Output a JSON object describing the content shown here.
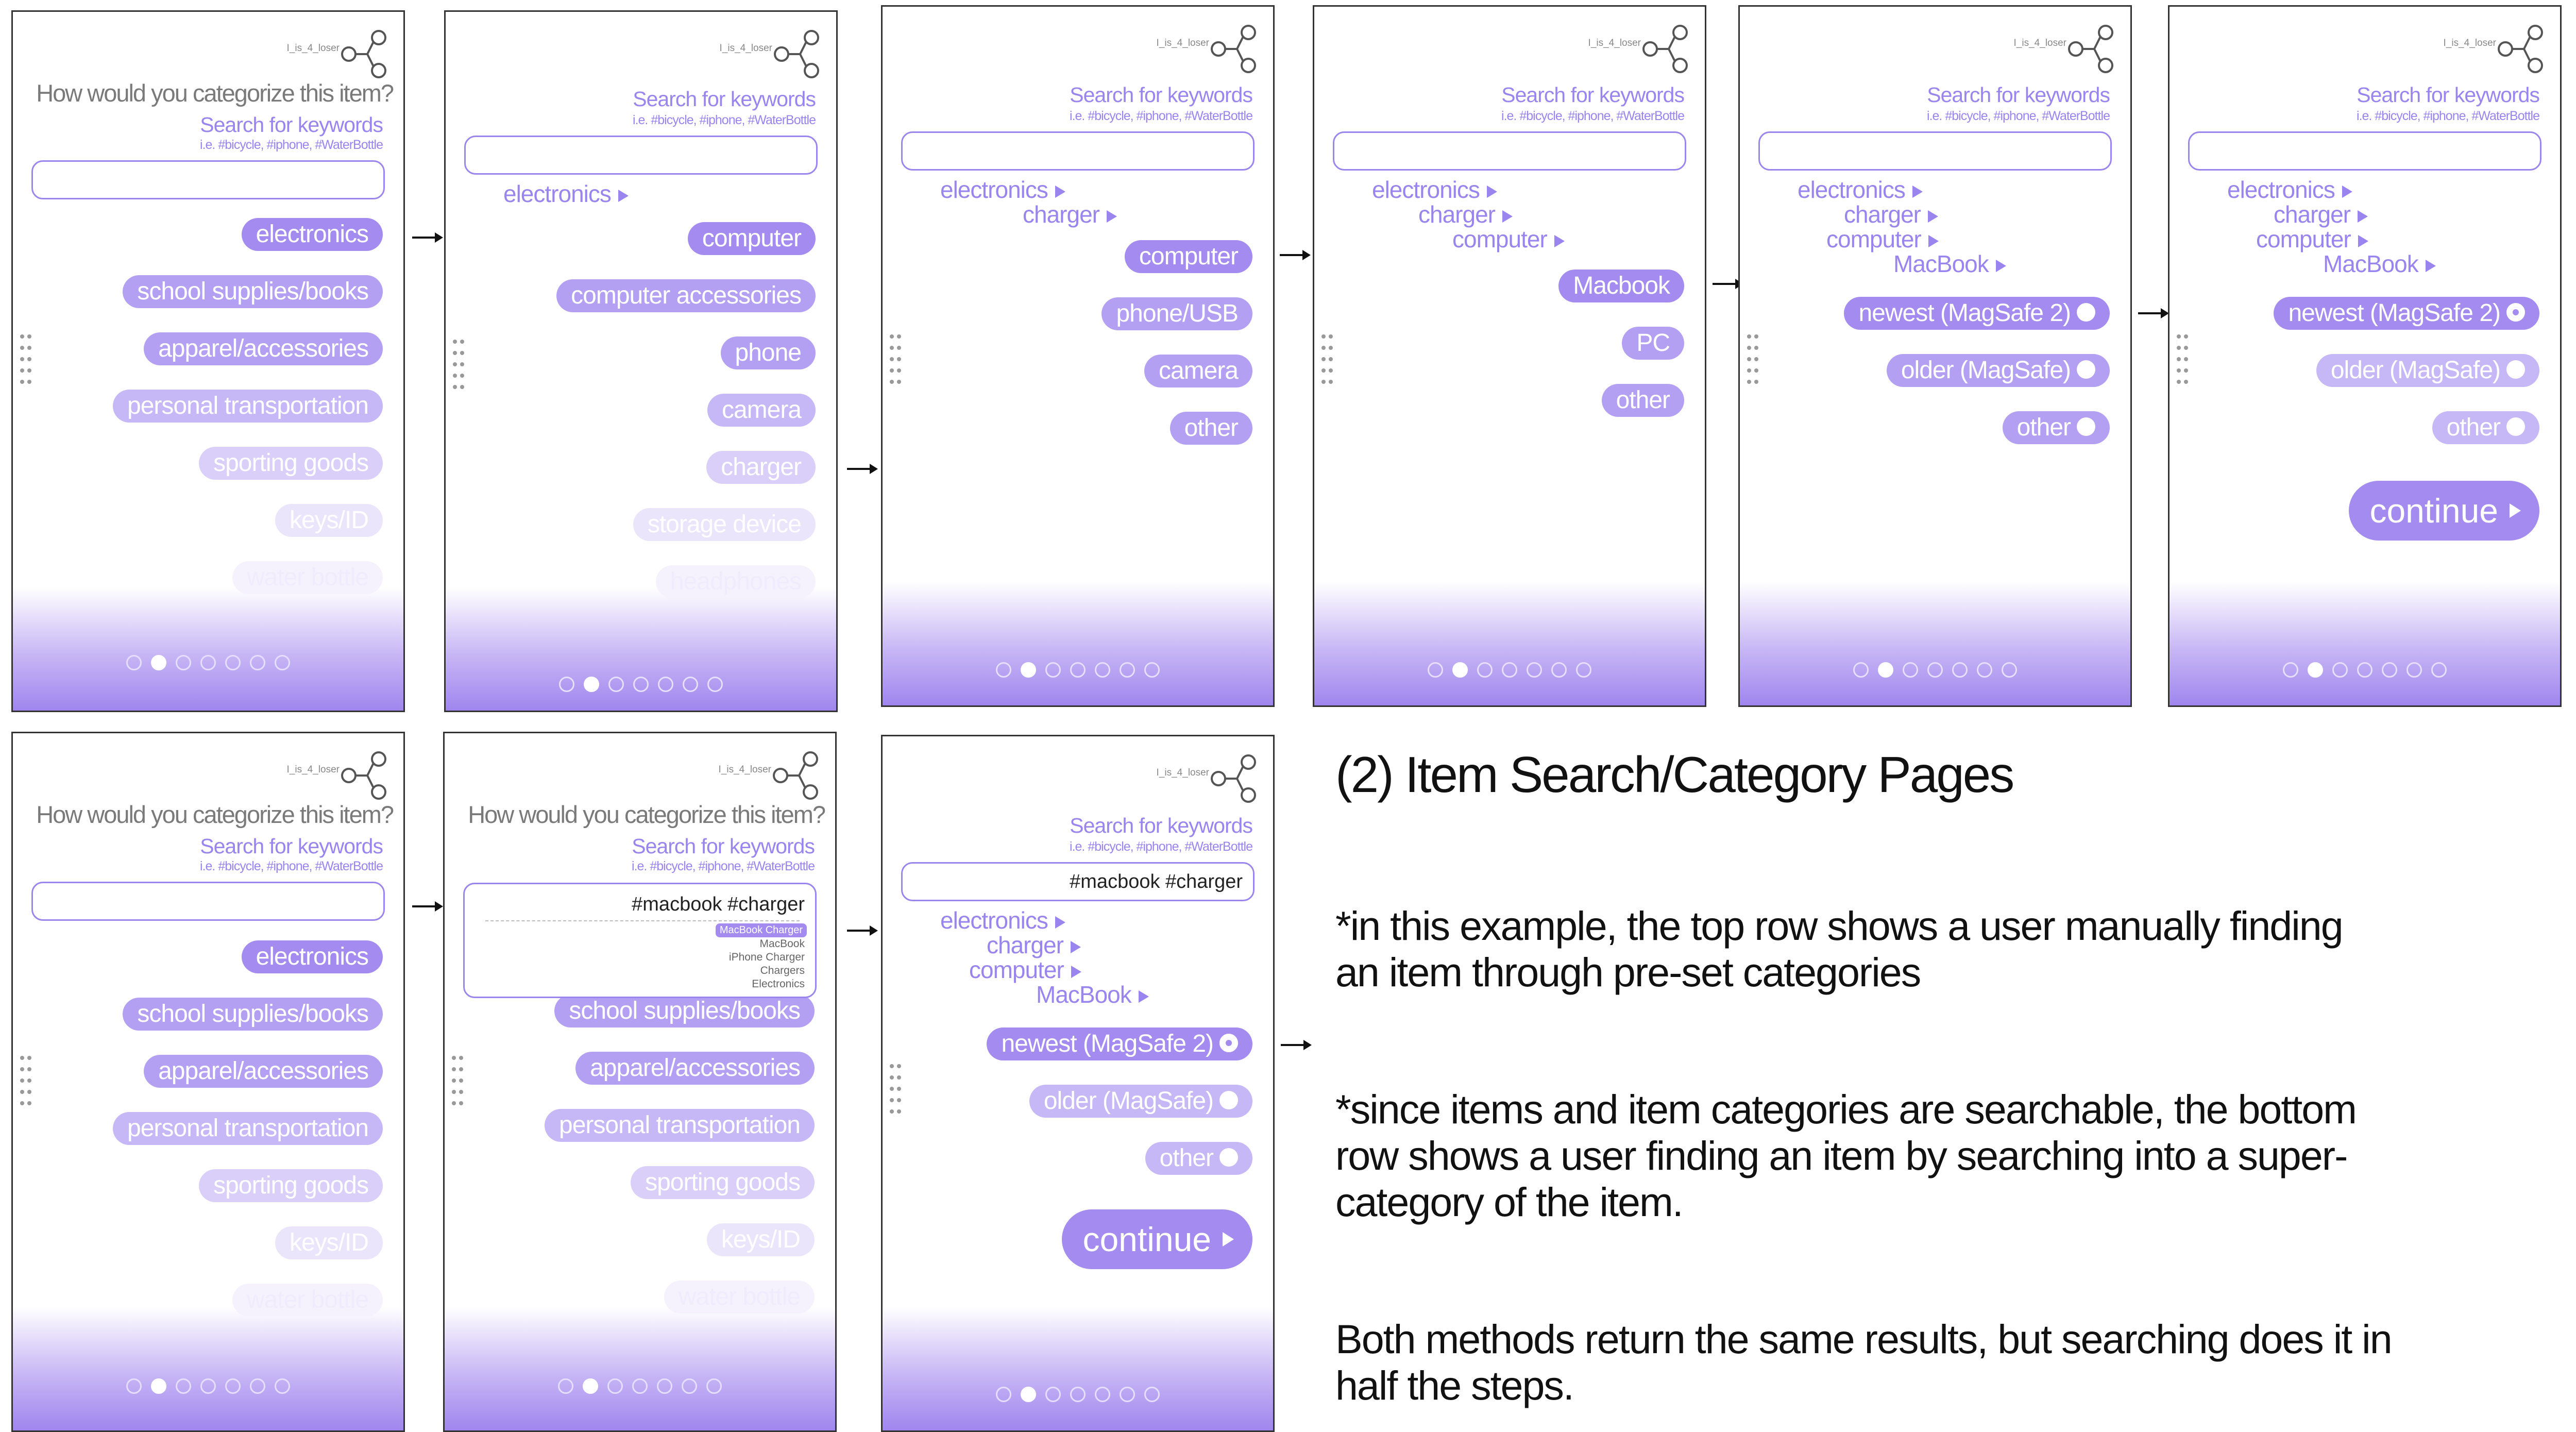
{
  "user_label": "I_is_4_loser",
  "question": "How would you categorize this item?",
  "search_keywords_title": "Search for keywords",
  "search_keywords_example": "i.e. #bicycle, #iphone, #WaterBottle",
  "search_query": "#macbook #charger",
  "categories_main": [
    "electronics",
    "school supplies/books",
    "apparel/accessories",
    "personal transportation",
    "sporting goods",
    "keys/ID",
    "water bottle"
  ],
  "categories_electronics": [
    "computer",
    "computer accessories",
    "phone",
    "camera",
    "charger",
    "storage device",
    "headphones"
  ],
  "categories_charger": [
    "computer",
    "phone/USB",
    "camera",
    "other"
  ],
  "categories_computer": [
    "Macbook",
    "PC",
    "other"
  ],
  "categories_macbook": [
    "newest (MagSafe 2)",
    "older (MagSafe)",
    "other"
  ],
  "crumbs": {
    "electronics": "electronics",
    "charger": "charger",
    "computer": "computer",
    "macbook": "MacBook"
  },
  "continue_label": "continue",
  "dropdown": {
    "selected": "MacBook Charger",
    "items": [
      "MacBook",
      "iPhone Charger",
      "Chargers",
      "Electronics"
    ]
  },
  "heading": "(2) Item Search/Category Pages",
  "note1": "*in this example, the top row shows a user manually finding an item through pre-set categories",
  "note2": "*since items and item categories are searchable, the bottom row shows a user finding an item by searching into a super-category of the item.",
  "note3": "Both methods return the same results, but searching does it in half the steps.",
  "colors": {
    "accent": "#a48bf0",
    "accent_text": "#9a84ee",
    "gradient_end": "#9f86ee"
  }
}
